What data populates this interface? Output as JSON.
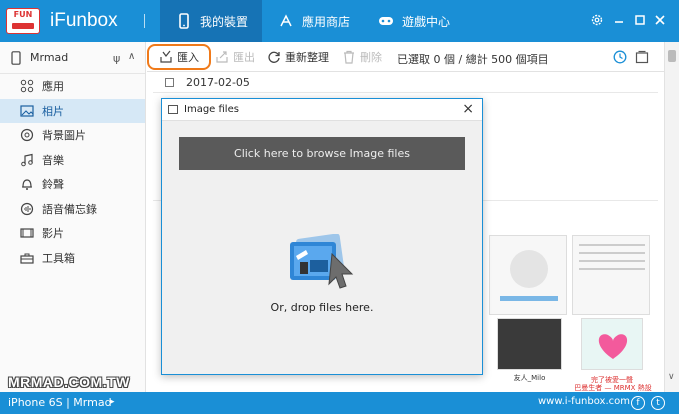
{
  "app": {
    "title": "iFunbox",
    "logo_text": "FUN"
  },
  "tabs": [
    {
      "label": "我的裝置",
      "icon": "phone-icon",
      "active": true
    },
    {
      "label": "應用商店",
      "icon": "appstore-icon",
      "active": false
    },
    {
      "label": "遊戲中心",
      "icon": "gamepad-icon",
      "active": false
    }
  ],
  "window_controls": [
    "settings-icon",
    "minimize-icon",
    "maximize-icon",
    "close-icon"
  ],
  "sidebar": {
    "device_name": "Mrmad",
    "items": [
      {
        "label": "應用",
        "icon": "apps-icon"
      },
      {
        "label": "相片",
        "icon": "photo-icon",
        "active": true
      },
      {
        "label": "背景圖片",
        "icon": "wallpaper-icon"
      },
      {
        "label": "音樂",
        "icon": "music-icon"
      },
      {
        "label": "鈴聲",
        "icon": "bell-icon"
      },
      {
        "label": "語音備忘錄",
        "icon": "voice-memo-icon"
      },
      {
        "label": "影片",
        "icon": "video-icon"
      },
      {
        "label": "工具箱",
        "icon": "toolbox-icon"
      }
    ]
  },
  "toolbar": {
    "import_label": "匯入",
    "export_label": "匯出",
    "refresh_label": "重新整理",
    "delete_label": "刪除",
    "selection_info": "已選取 0 個 / 總計 500 個項目"
  },
  "content": {
    "date_group": "2017-02-05",
    "thumb_caption_1": "友人_Milo",
    "thumb_caption_2": "完了被愛一聲",
    "thumb_caption_3": "巴曼生者 — MRMX 熱設定新聞"
  },
  "dialog": {
    "title": "Image files",
    "browse_label": "Click here to browse Image files",
    "drop_label": "Or, drop files here."
  },
  "watermark": "MRMAD.COM.TW",
  "statusbar": {
    "device_label": "iPhone 6S | Mrmad",
    "website": "www.i-funbox.com",
    "social": [
      "f",
      "t"
    ]
  },
  "colors": {
    "accent": "#1a8fd6",
    "accent_dark": "#1673b5",
    "highlight": "#f07a1a"
  }
}
